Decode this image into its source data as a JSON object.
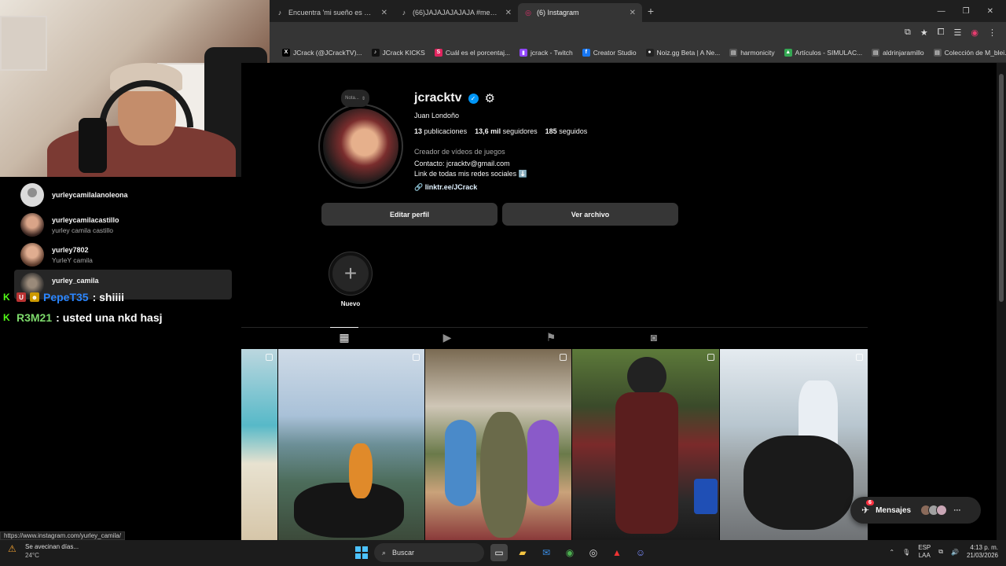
{
  "browser": {
    "tabs": [
      {
        "title": "Encuentra 'mi sueño es montar...",
        "icon": "tiktok-icon",
        "active": false
      },
      {
        "title": "(66)JAJAJAJAJAJA #meme #c...",
        "icon": "tiktok-icon",
        "active": false
      },
      {
        "title": "(6) Instagram",
        "icon": "instagram-icon",
        "active": true
      }
    ],
    "new_tab": "+",
    "bookmarks": [
      {
        "label": "JCrack (@JCrackTV)...",
        "icon": "x-icon",
        "color": "#000000"
      },
      {
        "label": "JCrack KICKS",
        "icon": "tiktok-icon",
        "color": "#111111"
      },
      {
        "label": "Cuál es el porcentaj...",
        "icon": "s-icon",
        "color": "#e0245e"
      },
      {
        "label": "jcrack - Twitch",
        "icon": "twitch-icon",
        "color": "#9146ff"
      },
      {
        "label": "Creator Studio",
        "icon": "facebook-icon",
        "color": "#1877f2"
      },
      {
        "label": "Noiz.gg Beta | A Ne...",
        "icon": "noiz-icon",
        "color": "#222222"
      },
      {
        "label": "harmonicity",
        "icon": "page-icon",
        "color": "#555555"
      },
      {
        "label": "Artículos - SIMULAC...",
        "icon": "drive-icon",
        "color": "#34a853"
      },
      {
        "label": "aldrinjaramillo",
        "icon": "page-icon",
        "color": "#555555"
      },
      {
        "label": "Colección de M_blei...",
        "icon": "page-icon",
        "color": "#555555"
      }
    ],
    "bookmarks_more": "»"
  },
  "search_results": [
    {
      "username": "yurleycamilalanoleona",
      "subtitle": "",
      "avatar": "gray",
      "active": false
    },
    {
      "username": "yurleycamilacastillo",
      "subtitle": "yurley camila castillo",
      "avatar": "p1",
      "active": false
    },
    {
      "username": "yurley7802",
      "subtitle": "YurleY camila",
      "avatar": "p2",
      "active": false
    },
    {
      "username": "yurley_camila",
      "subtitle": "",
      "avatar": "p3",
      "active": true
    }
  ],
  "chat": [
    {
      "user": "PepeT35",
      "message": ": shiiii",
      "user_color": "#2b86ff"
    },
    {
      "user": "R3M21",
      "message": ": usted una nkd hasj",
      "user_color": "#7dd96b"
    }
  ],
  "profile": {
    "note_label": "Nota...",
    "username": "jcracktv",
    "full_name": "Juan Londoño",
    "posts_count": "13",
    "posts_label": "publicaciones",
    "followers_count": "13,6 mil",
    "followers_label": "seguidores",
    "following_count": "185",
    "following_label": "seguidos",
    "category": "Creador de vídeos de juegos",
    "bio_line1": "Contacto: jcracktv@gmail.com",
    "bio_line2": "Link de todas mis redes sociales ⬇️",
    "link": "linktr.ee/JCrack",
    "edit_button": "Editar perfil",
    "archive_button": "Ver archivo",
    "highlight_new": "Nuevo"
  },
  "messages": {
    "label": "Mensajes",
    "badge": "6"
  },
  "status_url": "https://www.instagram.com/yurley_camila/",
  "taskbar": {
    "weather_title": "Se avecinan días...",
    "weather_temp": "24°C",
    "search_label": "Buscar",
    "lang_top": "ESP",
    "lang_bottom": "LAA",
    "time": "4:13 p. m.",
    "date": "21/03/2026"
  }
}
